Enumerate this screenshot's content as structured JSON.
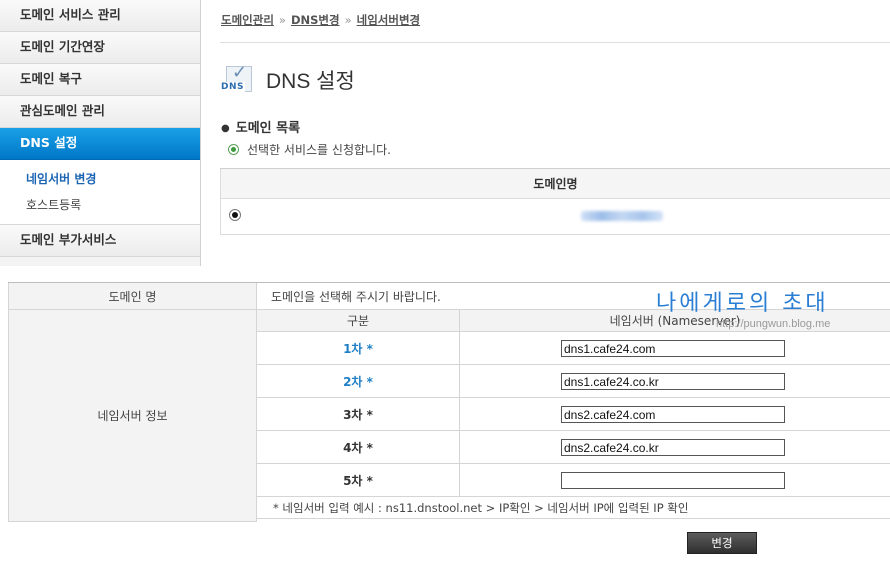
{
  "sidebar": {
    "items": [
      {
        "label": "도메인 서비스 관리"
      },
      {
        "label": "도메인 기간연장"
      },
      {
        "label": "도메인 복구"
      },
      {
        "label": "관심도메인 관리"
      },
      {
        "label": "DNS 설정"
      }
    ],
    "subitems": [
      {
        "label": "네임서버 변경"
      },
      {
        "label": "호스트등록"
      }
    ],
    "bottom_item": {
      "label": "도메인 부가서비스"
    }
  },
  "breadcrumb": {
    "items": [
      "도메인관리",
      "DNS변경",
      "네임서버변경"
    ],
    "separator": "»"
  },
  "page": {
    "icon_label": "DNS",
    "title": "DNS 설정"
  },
  "domain_list": {
    "section_title": "도메인 목록",
    "notice": "선택한 서비스를 신청합니다.",
    "column_header": "도메인명"
  },
  "form": {
    "domain_label": "도메인 명",
    "domain_value": "도메인을 선택해 주시기 바랍니다.",
    "ns_label": "네임서버 정보",
    "col_type": "구분",
    "col_ns": "네임서버 (Nameserver)",
    "rows": [
      {
        "label": "1차 *",
        "value": "dns1.cafe24.com"
      },
      {
        "label": "2차 *",
        "value": "dns1.cafe24.co.kr"
      },
      {
        "label": "3차 *",
        "value": "dns2.cafe24.com"
      },
      {
        "label": "4차 *",
        "value": "dns2.cafe24.co.kr"
      },
      {
        "label": "5차 *",
        "value": ""
      }
    ],
    "example": "* 네임서버 입력 예시 : ns11.dnstool.net > IP확인 > 네임서버 IP에 입력된 IP 확인",
    "submit_label": "변경"
  },
  "watermark": {
    "title": "나에게로의 초대",
    "url": "http://pungwun.blog.me"
  },
  "colors": {
    "active_menu": "#0a86d4",
    "row_label_blue": "#1e7fc5",
    "watermark": "#2a7fd4"
  }
}
